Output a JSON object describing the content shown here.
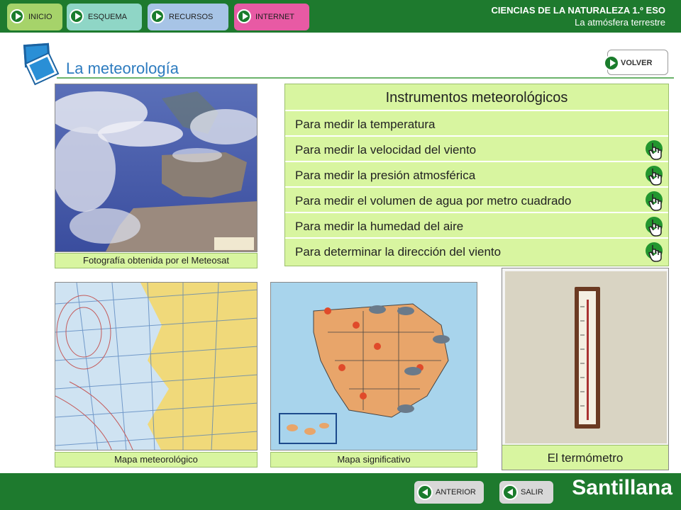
{
  "header": {
    "nav": [
      {
        "label": "INICIO",
        "color": "#a6d36a"
      },
      {
        "label": "ESQUEMA",
        "color": "#8fd6c6"
      },
      {
        "label": "RECURSOS",
        "color": "#a7c4e6"
      },
      {
        "label": "INTERNET",
        "color": "#e85aa4"
      }
    ],
    "title_line1": "CIENCIAS DE LA NATURALEZA 1.º ESO",
    "title_line2": "La atmósfera terrestre"
  },
  "page": {
    "title": "La meteorología",
    "back_label": "VOLVER"
  },
  "images": {
    "meteosat_caption": "Fotografía obtenida por el Meteosat",
    "weather_map_caption": "Mapa meteorológico",
    "significant_map_caption": "Mapa significativo",
    "thermometer_caption": "El termómetro"
  },
  "instruments": {
    "heading": "Instrumentos meteorológicos",
    "rows": [
      {
        "label": "Para medir la temperatura",
        "has_link": false
      },
      {
        "label": "Para medir la velocidad del viento",
        "has_link": true
      },
      {
        "label": "Para medir la presión atmosférica",
        "has_link": true
      },
      {
        "label": "Para medir el volumen de agua por metro cuadrado",
        "has_link": true
      },
      {
        "label": "Para medir la humedad del aire",
        "has_link": true
      },
      {
        "label": "Para determinar la dirección del viento",
        "has_link": true
      }
    ]
  },
  "footer": {
    "prev_label": "ANTERIOR",
    "exit_label": "SALIR",
    "brand": "Santillana"
  }
}
